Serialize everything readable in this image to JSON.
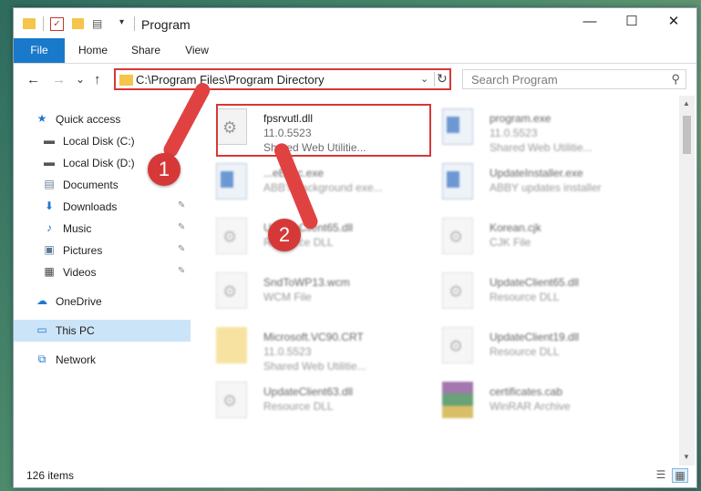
{
  "window": {
    "title": "Program",
    "minimize": "—",
    "maximize": "☐",
    "close": "✕"
  },
  "ribbon": {
    "tabs": [
      "File",
      "Home",
      "Share",
      "View"
    ]
  },
  "nav": {
    "back": "←",
    "forward": "→",
    "recent": "⌄",
    "up": "↑"
  },
  "address": {
    "path": "C:\\Program Files\\Program Directory",
    "refresh": "↻",
    "chevron": "⌄"
  },
  "search": {
    "placeholder": "Search Program",
    "icon": "⚲"
  },
  "sidebar": {
    "items": [
      {
        "label": "Quick access",
        "icon": "★",
        "icon_color": "#1f77d0"
      },
      {
        "label": "Local Disk (C:)",
        "icon": "▬",
        "icon_color": "#555"
      },
      {
        "label": "Local Disk (D:)",
        "icon": "▬",
        "icon_color": "#555"
      },
      {
        "label": "Documents",
        "icon": "▤",
        "icon_color": "#6b7f95"
      },
      {
        "label": "Downloads",
        "icon": "⬇",
        "icon_color": "#1f77d0"
      },
      {
        "label": "Music",
        "icon": "♪",
        "icon_color": "#1f77d0"
      },
      {
        "label": "Pictures",
        "icon": "▣",
        "icon_color": "#5a7896"
      },
      {
        "label": "Videos",
        "icon": "▦",
        "icon_color": "#444"
      },
      {
        "label": "OneDrive",
        "icon": "☁",
        "icon_color": "#1f77d0"
      },
      {
        "label": "This PC",
        "icon": "▭",
        "icon_color": "#1f77d0"
      },
      {
        "label": "Network",
        "icon": "⧉",
        "icon_color": "#1f77d0"
      }
    ],
    "pin": "📌"
  },
  "files": [
    {
      "name": "fpsrvutl.dll",
      "line2": "11.0.5523",
      "line3": "Shared Web Utilitie...",
      "icon": "dll"
    },
    {
      "name": "program.exe",
      "line2": "11.0.5523",
      "line3": "Shared Web Utilitie...",
      "icon": "exe"
    },
    {
      "name": "...eExec.exe",
      "line2": "ABBY background exe...",
      "line3": "",
      "icon": "exe"
    },
    {
      "name": "UpdateInstaller.exe",
      "line2": "ABBY updates installer",
      "line3": "",
      "icon": "exe"
    },
    {
      "name": "UpdateClient65.dll",
      "line2": "Resource DLL",
      "line3": "",
      "icon": "dll"
    },
    {
      "name": "Korean.cjk",
      "line2": "CJK File",
      "line3": "",
      "icon": "dll"
    },
    {
      "name": "SndToWP13.wcm",
      "line2": "WCM File",
      "line3": "",
      "icon": "dll"
    },
    {
      "name": "UpdateClient65.dll",
      "line2": "Resource DLL",
      "line3": "",
      "icon": "dll"
    },
    {
      "name": "Microsoft.VC90.CRT",
      "line2": "11.0.5523",
      "line3": "Shared Web Utilitie...",
      "icon": "folder"
    },
    {
      "name": "UpdateClient19.dll",
      "line2": "Resource DLL",
      "line3": "",
      "icon": "dll"
    },
    {
      "name": "UpdateClient63.dll",
      "line2": "Resource DLL",
      "line3": "",
      "icon": "dll"
    },
    {
      "name": "certificates.cab",
      "line2": "WinRAR Archive",
      "line3": "",
      "icon": "archive"
    }
  ],
  "status": {
    "count": "126 items"
  },
  "annotations": {
    "badge1": "1",
    "badge2": "2"
  },
  "colors": {
    "accent": "#1979ca",
    "highlight": "#d63838",
    "selected": "#cce4f7"
  }
}
